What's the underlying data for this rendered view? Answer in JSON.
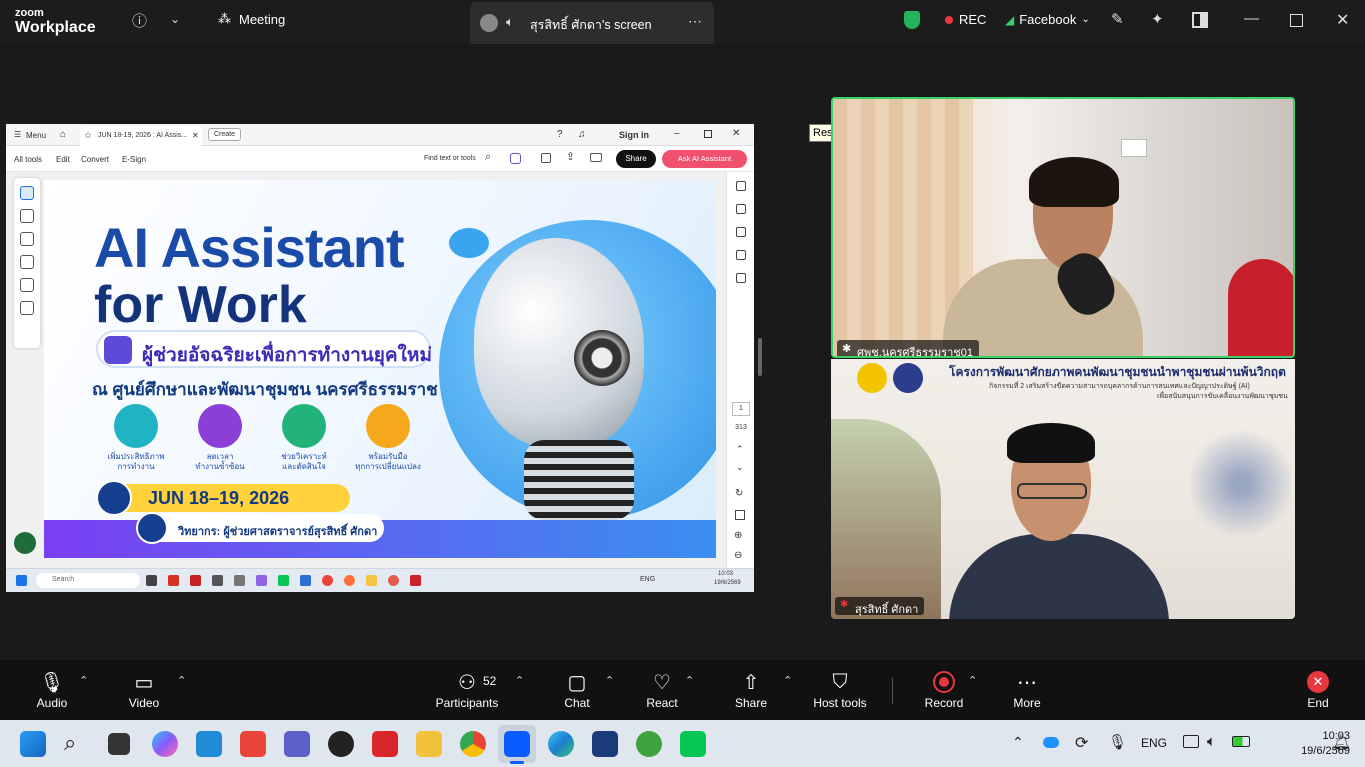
{
  "titlebar": {
    "logo_small": "zoom",
    "logo_big": "Workplace",
    "meeting_label": "Meeting",
    "share_tab_label": "สุรสิทธิ์ ศักดา's screen",
    "rec_label": "REC",
    "facebook_label": "Facebook"
  },
  "shared_screen": {
    "pdf_top": {
      "menu": "Menu",
      "tab_title": "JUN 18-19, 2026 : AI Assis...",
      "create": "Create",
      "sign_in": "Sign in"
    },
    "pdf_toolbar": {
      "all_tools": "All tools",
      "edit": "Edit",
      "convert": "Convert",
      "esign": "E-Sign",
      "find": "Find text or tools",
      "share": "Share",
      "ask_ai": "Ask AI Assistant"
    },
    "page_current": "1",
    "page_total": "313",
    "banner": {
      "title1": "AI Assistant",
      "title2": "for Work",
      "pill": "ผู้ช่วยอัจฉริยะเพื่อการทำงานยุคใหม่",
      "subtitle": "ณ ศูนย์ศึกษาและพัฒนาชุมชน นครศรีธรรมราช",
      "features": [
        {
          "line1": "เพิ่มประสิทธิภาพ",
          "line2": "การทำงาน"
        },
        {
          "line1": "ลดเวลา",
          "line2": "ทำงานซ้ำซ้อน"
        },
        {
          "line1": "ช่วยวิเคราะห์",
          "line2": "และตัดสินใจ"
        },
        {
          "line1": "พร้อมรับมือ",
          "line2": "ทุกการเปลี่ยนแปลง"
        }
      ],
      "date": "JUN 18–19, 2026",
      "speaker": "วิทยากร: ผู้ช่วยศาสตราจารย์สุรสิทธิ์ ศักดา"
    },
    "inner_taskbar": {
      "search": "Search",
      "lang": "ENG",
      "time": "10:03",
      "date": "19/6/2569"
    }
  },
  "tiles": [
    {
      "name": "ศพช.นครศรีธรรมราช01"
    },
    {
      "name": "สุรสิทธิ์ ศักดา",
      "bg_title": "โครงการพัฒนาศักยภาพคนพัฒนาชุมชนนำพาชุมชนผ่านพ้นวิกฤต",
      "bg_subtitle": "กิจกรรมที่ 2 เสริมสร้างขีดความสามารถบุคลากรด้านการสนเทศและปัญญาประดิษฐ์ (AI)",
      "bg_subtitle2": "เพื่อสนับสนุนการขับเคลื่อนงานพัฒนาชุมชน"
    }
  ],
  "tooltip": "Restore Up",
  "toolbar": {
    "audio": "Audio",
    "video": "Video",
    "participants": "Participants",
    "participants_count": "52",
    "chat": "Chat",
    "react": "React",
    "share": "Share",
    "host_tools": "Host tools",
    "record": "Record",
    "more": "More",
    "end": "End"
  },
  "windows_taskbar": {
    "lang": "ENG",
    "time": "10:03",
    "date": "19/6/2569"
  },
  "colors": {
    "active_speaker": "#3ad36a",
    "record_red": "#e8383d",
    "banner_blue": "#1a4ba8"
  }
}
